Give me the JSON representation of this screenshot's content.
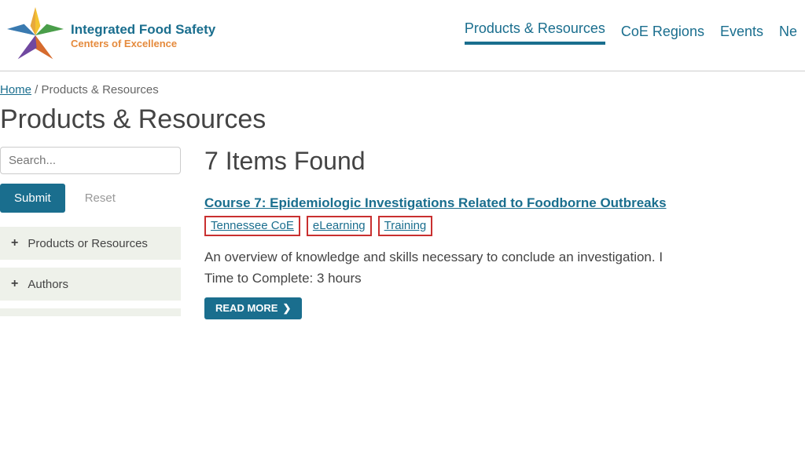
{
  "logo": {
    "title": "Integrated Food Safety",
    "subtitle": "Centers of Excellence"
  },
  "nav": {
    "items": [
      "Products & Resources",
      "CoE Regions",
      "Events",
      "Ne"
    ]
  },
  "breadcrumb": {
    "home": "Home",
    "sep": " / ",
    "current": "Products & Resources"
  },
  "page_title": "Products & Resources",
  "search": {
    "placeholder": "Search...",
    "submit_label": "Submit",
    "reset_label": "Reset"
  },
  "filters": {
    "items": [
      "Products or Resources",
      "Authors"
    ]
  },
  "results": {
    "heading": "7 Items Found",
    "item": {
      "title": "Course 7: Epidemiologic Investigations Related to Foodborne Outbreaks",
      "tags": [
        "Tennessee CoE",
        "eLearning",
        "Training"
      ],
      "description": "An overview of knowledge and skills necessary to conclude an investigation. I",
      "time": "Time to Complete: 3 hours",
      "read_more": "READ MORE"
    }
  }
}
